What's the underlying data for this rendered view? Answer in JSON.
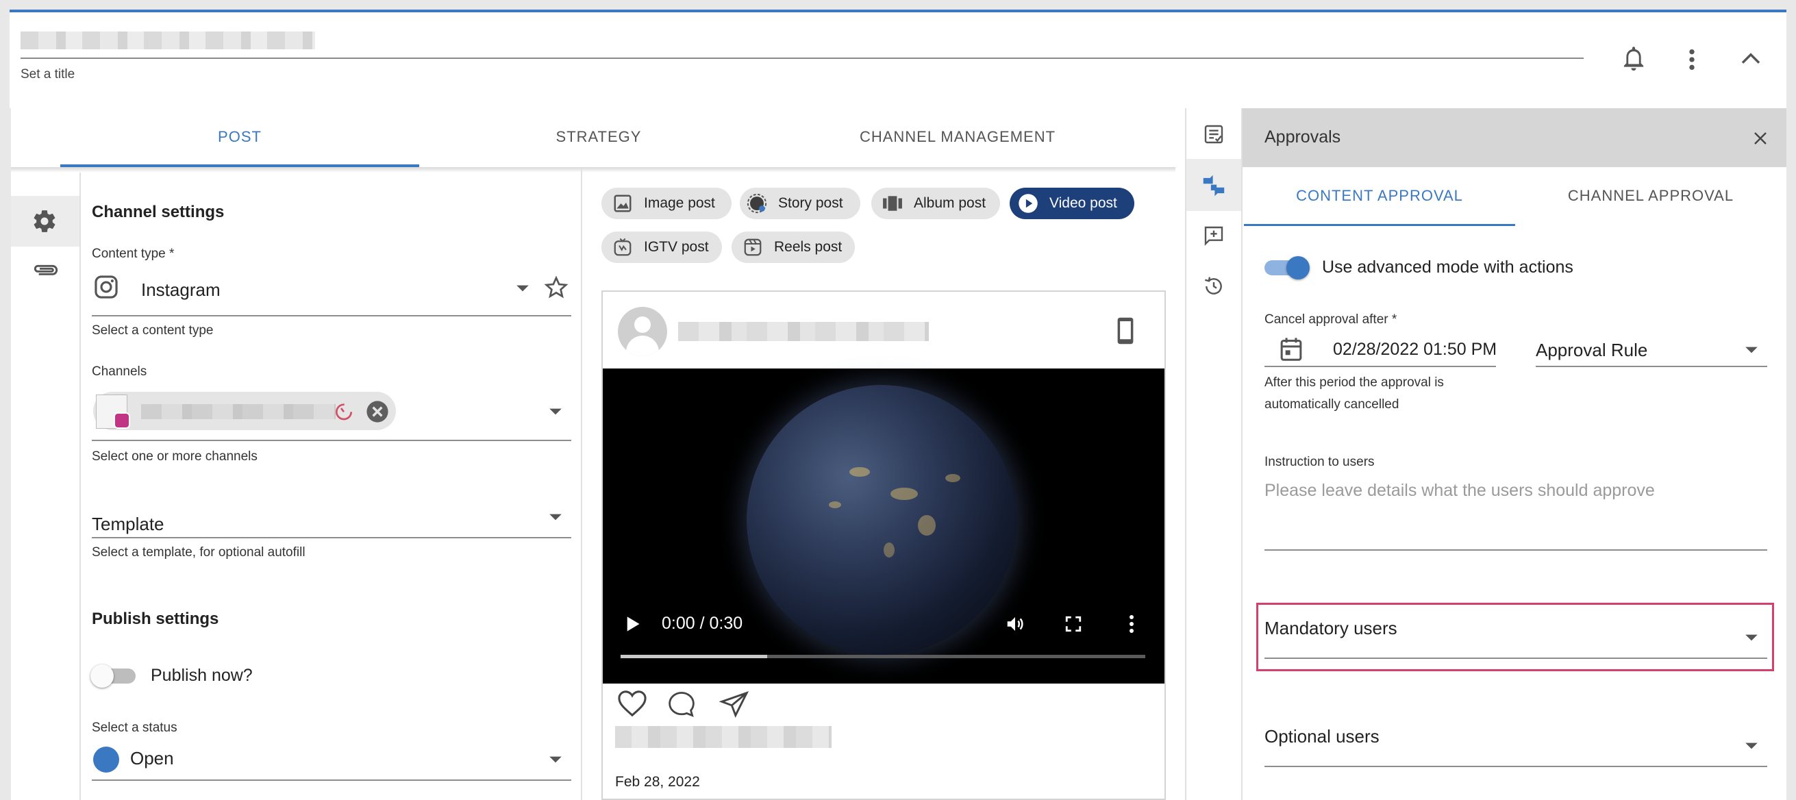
{
  "header": {
    "title_helper": "Set a title"
  },
  "tabs": [
    {
      "label": "POST"
    },
    {
      "label": "STRATEGY"
    },
    {
      "label": "CHANNEL MANAGEMENT"
    }
  ],
  "channel_settings": {
    "title": "Channel settings",
    "content_type_label": "Content type *",
    "content_type_value": "Instagram",
    "content_type_helper": "Select a content type",
    "channels_label": "Channels",
    "channels_helper": "Select one or more channels",
    "template_label": "Template",
    "template_helper": "Select a template, for optional autofill"
  },
  "publish_settings": {
    "title": "Publish settings",
    "publish_now_label": "Publish now?",
    "status_label": "Select a status",
    "status_value": "Open",
    "status_color": "#3a79c2"
  },
  "post_types": [
    {
      "label": "Image post"
    },
    {
      "label": "Story post"
    },
    {
      "label": "Album post"
    },
    {
      "label": "Video post",
      "selected": true
    },
    {
      "label": "IGTV post"
    },
    {
      "label": "Reels post"
    }
  ],
  "preview": {
    "time": "0:00 / 0:30",
    "progress": 0.28,
    "date": "Feb 28, 2022"
  },
  "approvals": {
    "title": "Approvals",
    "tabs": [
      {
        "label": "CONTENT APPROVAL"
      },
      {
        "label": "CHANNEL APPROVAL"
      }
    ],
    "advanced_mode_label": "Use advanced mode with actions",
    "cancel_label": "Cancel approval after *",
    "cancel_value": "02/28/2022 01:50 PM",
    "cancel_helper_1": "After this period the approval is",
    "cancel_helper_2": "automatically cancelled",
    "rule_value": "Approval Rule",
    "instruction_label": "Instruction to users",
    "instruction_placeholder": "Please leave details what the users should approve",
    "mandatory_label": "Mandatory users",
    "optional_label": "Optional users"
  },
  "colors": {
    "accent": "#3a79c2",
    "highlight": "#d2406d",
    "instagram": "#c13584"
  }
}
